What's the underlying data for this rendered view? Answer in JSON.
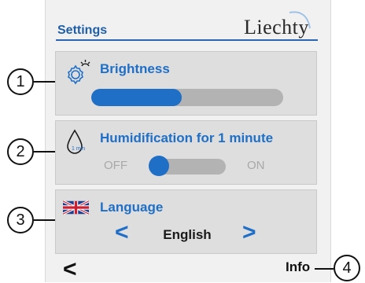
{
  "header": {
    "title": "Settings",
    "brand": "Liechty"
  },
  "brightness": {
    "label": "Brightness",
    "icon": "gear-sun-icon",
    "level_percent": 47
  },
  "humidification": {
    "label": "Humidification for 1 minute",
    "icon": "droplet-1min-icon",
    "icon_text": "1 min",
    "off_label": "OFF",
    "on_label": "ON",
    "state": "OFF"
  },
  "language": {
    "label": "Language",
    "icon": "uk-flag-icon",
    "value": "English",
    "prev_glyph": "<",
    "next_glyph": ">"
  },
  "footer": {
    "back_glyph": "<",
    "info_label": "Info"
  },
  "callouts": [
    "1",
    "2",
    "3",
    "4"
  ],
  "colors": {
    "accent": "#1f6fc7",
    "panel": "#dedede",
    "track": "#b3b3b3"
  }
}
